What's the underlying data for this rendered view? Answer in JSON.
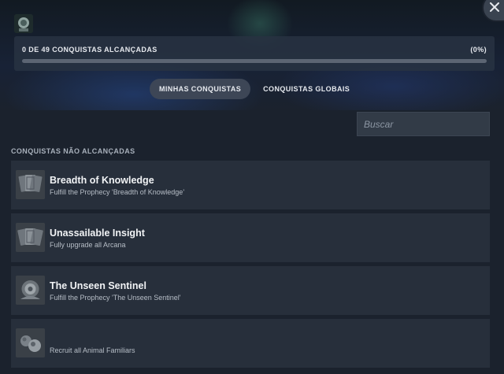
{
  "header": {
    "progress_text": "0 DE 49 CONQUISTAS ALCANÇADAS",
    "progress_percent": "(0%)",
    "progress_value": 0
  },
  "tabs": [
    {
      "label": "MINHAS CONQUISTAS",
      "active": true
    },
    {
      "label": "CONQUISTAS GLOBAIS",
      "active": false
    }
  ],
  "search": {
    "placeholder": "Buscar",
    "value": ""
  },
  "section": {
    "title": "CONQUISTAS NÃO ALCANÇADAS"
  },
  "achievements": [
    {
      "name": "Breadth of Knowledge",
      "description": "Fulfill the Prophecy 'Breadth of Knowledge'",
      "icon": "cards-icon"
    },
    {
      "name": "Unassailable Insight",
      "description": "Fully upgrade all Arcana",
      "icon": "cards-icon"
    },
    {
      "name": "The Unseen Sentinel",
      "description": "Fulfill the Prophecy 'The Unseen Sentinel'",
      "icon": "sentinel-icon"
    },
    {
      "name": "",
      "description": "Recruit all Animal Familiars",
      "icon": "familiars-icon"
    }
  ],
  "colors": {
    "accent": "#1a9fff",
    "background": "#1b222d",
    "card": "#272f3b"
  }
}
